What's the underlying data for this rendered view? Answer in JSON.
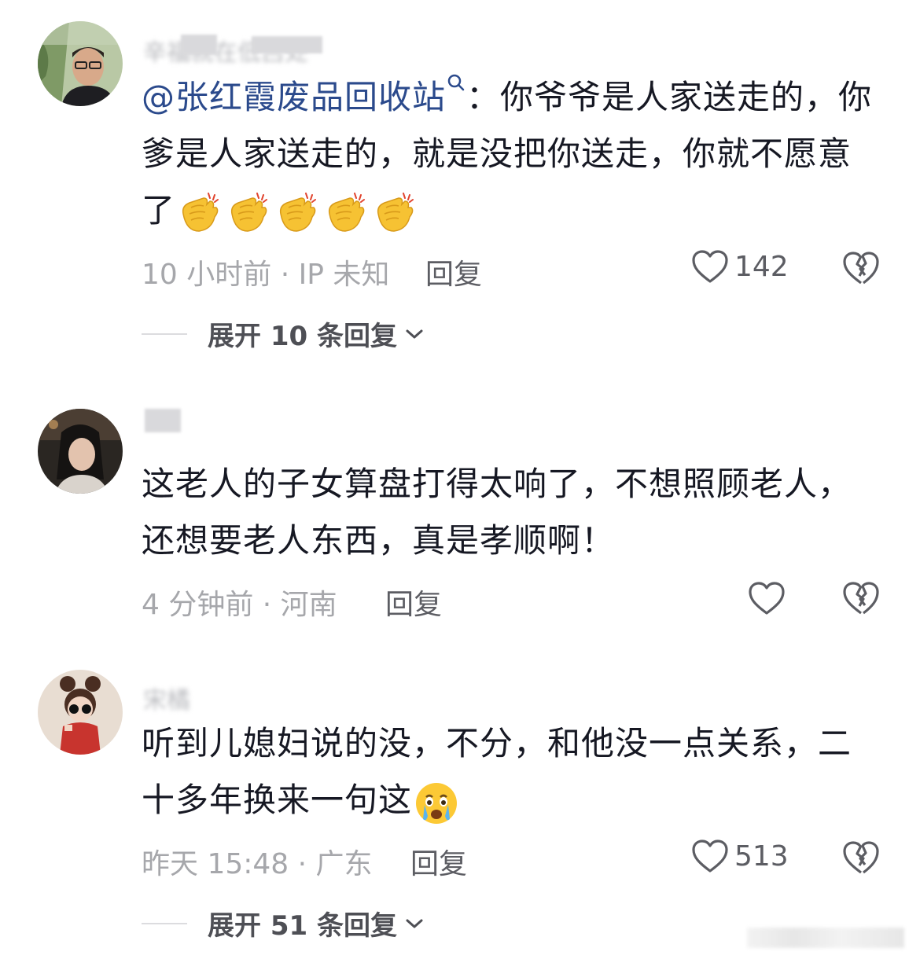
{
  "comments": [
    {
      "username": "辛福就在低吕处",
      "mention": "@张红霞废品回收站",
      "text": "：你爷爷是人家送走的，你爹是人家送走的，就是没把你送走，你就不愿意了",
      "time": "10 小时前 · IP 未知",
      "reply": "回复",
      "likes": "142",
      "expand": "展开 10 条回复",
      "emoji": [
        "clapping-hands",
        "clapping-hands",
        "clapping-hands",
        "clapping-hands",
        "clapping-hands"
      ]
    },
    {
      "username": "",
      "text": "这老人的子女算盘打得太响了，不想照顾老人，还想要老人东西，真是孝顺啊！",
      "time": "4 分钟前 · 河南",
      "reply": "回复"
    },
    {
      "username": "宋橘",
      "text": "听到儿媳妇说的没，不分，和他没一点关系，二十多年换来一句这",
      "time": "昨天 15:48 · 广东",
      "reply": "回复",
      "likes": "513",
      "expand": "展开 51 条回复",
      "emoji": [
        "crying-face"
      ]
    }
  ],
  "colors": {
    "mention": "#2b4a8c",
    "meta": "#a6a7ab",
    "text": "#161823"
  }
}
